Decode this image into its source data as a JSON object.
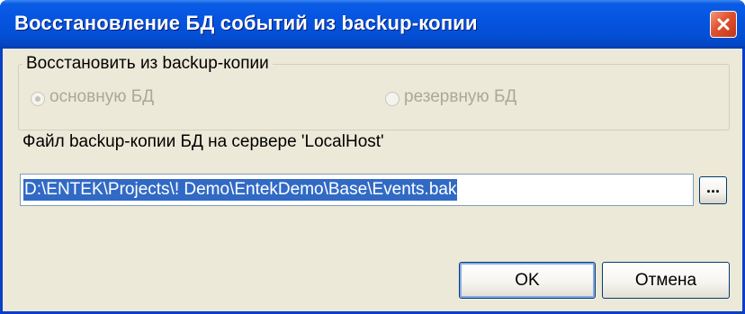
{
  "window": {
    "title": "Восстановление БД событий из backup-копии"
  },
  "restore_group": {
    "legend": "Восстановить из backup-копии",
    "options": [
      {
        "label": "основную БД",
        "selected": true,
        "enabled": false
      },
      {
        "label": "резервную БД",
        "selected": false,
        "enabled": false
      }
    ]
  },
  "file": {
    "label": "Файл backup-копии БД на сервере 'LocalHost'",
    "path_value": "D:\\ENTEK\\Projects\\! Demo\\EntekDemo\\Base\\Events.bak",
    "browse_label": "..."
  },
  "buttons": {
    "ok_label": "OK",
    "cancel_label": "Отмена"
  },
  "colors": {
    "titlebar": "#0554e0",
    "dialog_bg": "#ece9d8",
    "selection": "#316ac5",
    "close_button": "#e0512e"
  },
  "icons": {
    "close": "close-icon"
  }
}
